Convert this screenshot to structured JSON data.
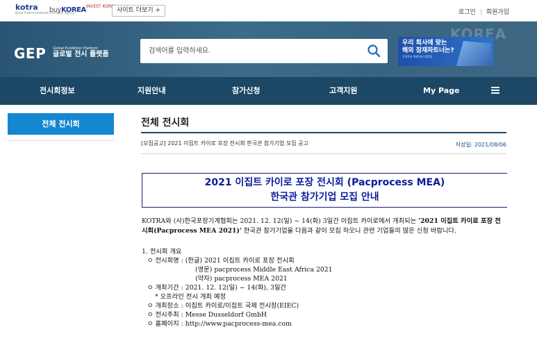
{
  "topbar": {
    "logo_kotra": "kotra",
    "logo_kotra_sub": "Korea Trade-Investment Promotion Agency",
    "logo_buykorea_prefix": "buy",
    "logo_buykorea": "KOREA",
    "logo_invest": "INVEST KOREA",
    "site_button": "사이트 더보기 +",
    "login": "로그인",
    "signup": "회원가입"
  },
  "hero": {
    "brand": "GEP",
    "brand_sub_en": "Global Exhibition Platform",
    "brand_sub_ko": "글로벌 전시 플랫폼",
    "search_placeholder": "검색어를 입력하세요.",
    "banner_line1": "우리 회사에 맞는",
    "banner_line2": "해외 잠재파트너는?",
    "banner_sub": "무역투자 빅데이터 플랫폼",
    "bg_word": "KOREA"
  },
  "nav": {
    "items": [
      "전시회정보",
      "지원안내",
      "참가신청",
      "고객지원",
      "My Page"
    ]
  },
  "sidebar": {
    "active": "전체 전시회"
  },
  "content": {
    "page_title": "전체 전시회",
    "notice_title": "[모집공고] 2021 이집트 카이로 포장 전시회 한국관 참가기업 모집 공고",
    "notice_date": "작성일: 2021/08/06",
    "headline_line1": "2021 이집트 카이로 포장 전시회 (Pacprocess MEA)",
    "headline_line2": "한국관 참가기업 모집 안내",
    "intro_part1": "KOTRA와 (사)한국포장기계협회는 2021. 12. 12(일) ~ 14(화) 3일간 이집트 카이로에서 개최되는 ",
    "intro_bold": "'2021 이집트 카이로 포장 전시회(Pacprocess MEA 2021)'",
    "intro_part2": " 한국관 참가기업을 다음과 같이 모집 하오니 관련 기업들의 많은 신청 바랍니다.",
    "outline": {
      "heading": "1. 전시회 개요",
      "name_label": "ㅇ 전시회명 : (한글) 2021 이집트 카이로 포장 전시회",
      "name_en": "(영문) pacprocess Middle East Africa 2021",
      "name_abbr": "(약자) pacprocess MEA 2021",
      "period": "ㅇ 개최기간 : 2021. 12. 12(일) ~ 14(화), 3일간",
      "period_note": "* 오프라인 전시 개최 예정",
      "venue": "ㅇ 개최장소 : 이집트 카이로/이집트 국제 전시장(EIEC)",
      "organizer": "ㅇ 전시주최 : Messe Dusseldorf GmbH",
      "homepage": "ㅇ 홈페이지 : http://www.pacprocess-mea.com"
    }
  },
  "colors": {
    "nav_bg": "#1c4765",
    "hero_bg": "#2d5876",
    "sidebar_active": "#1487d0",
    "headline_text": "#0b1b9a"
  }
}
